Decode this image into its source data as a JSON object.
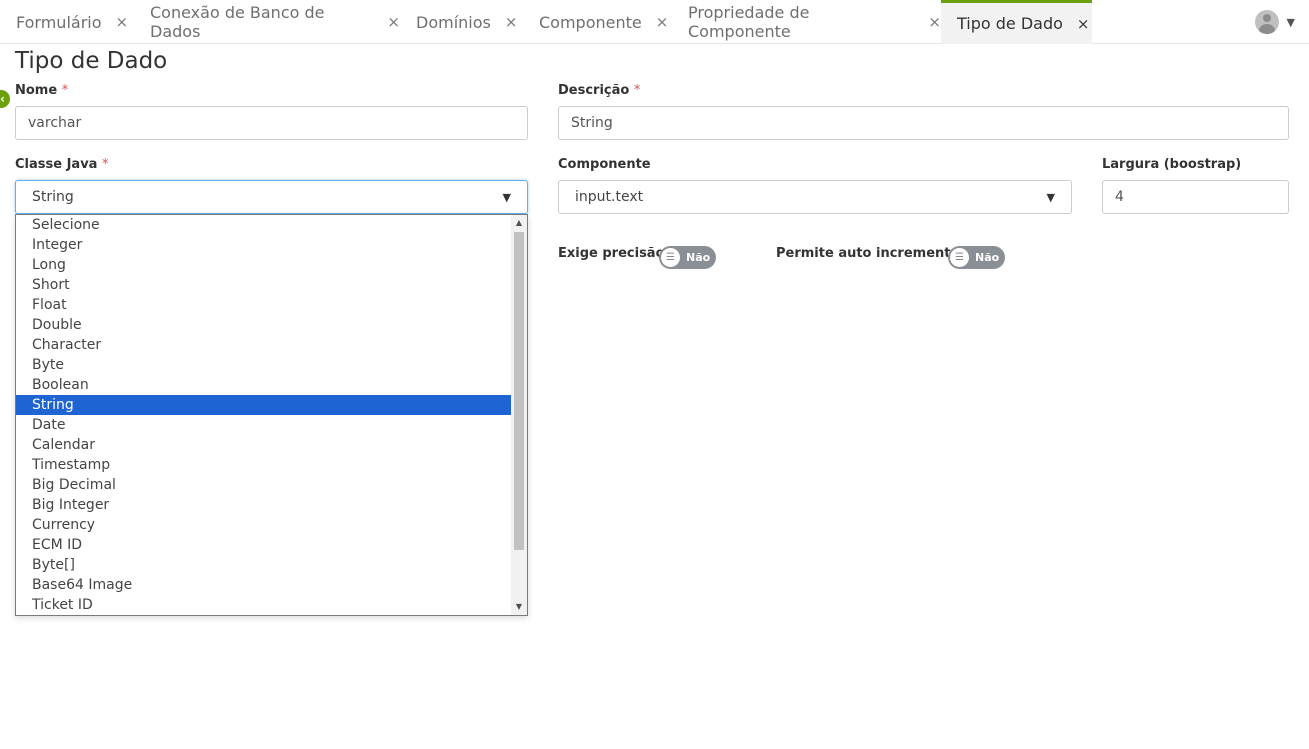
{
  "tabs": [
    {
      "label": "Formulário",
      "close": "×"
    },
    {
      "label": "Conexão de Banco de Dados",
      "close": "×"
    },
    {
      "label": "Domínios",
      "close": "×"
    },
    {
      "label": "Componente",
      "close": "×"
    },
    {
      "label": "Propriedade de Componente",
      "close": "×"
    },
    {
      "label": "Tipo de Dado",
      "close": "×"
    }
  ],
  "active_tab_index": 5,
  "colors": {
    "accent": "#6aa10b",
    "selection": "#1e65d3",
    "required": "#d9534f",
    "toggle_off": "#8a8f96"
  },
  "page": {
    "title": "Tipo de Dado",
    "back_icon": "chevron-left-icon"
  },
  "form": {
    "nome": {
      "label": "Nome",
      "required": "*",
      "value": "varchar"
    },
    "descricao": {
      "label": "Descrição",
      "required": "*",
      "value": "String"
    },
    "classe_java": {
      "label": "Classe Java",
      "required": "*",
      "value": "String",
      "options": [
        "Selecione",
        "Integer",
        "Long",
        "Short",
        "Float",
        "Double",
        "Character",
        "Byte",
        "Boolean",
        "String",
        "Date",
        "Calendar",
        "Timestamp",
        "Big Decimal",
        "Big Integer",
        "Currency",
        "ECM ID",
        "Byte[]",
        "Base64 Image",
        "Ticket ID"
      ],
      "selected_index": 9
    },
    "componente": {
      "label": "Componente",
      "value": "input.text"
    },
    "largura": {
      "label": "Largura (boostrap)",
      "value": "4"
    },
    "exige_precisao": {
      "label": "Exige precisão",
      "toggle": "Não"
    },
    "auto_incremento": {
      "label": "Permite auto incremento",
      "toggle": "Não"
    }
  }
}
